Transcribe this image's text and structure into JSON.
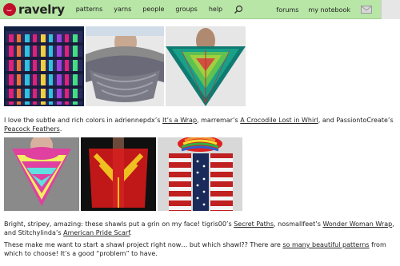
{
  "header": {
    "logo_text": "ravelry",
    "nav": [
      "patterns",
      "yarns",
      "people",
      "groups",
      "help"
    ],
    "right_nav": [
      "forums",
      "my notebook"
    ],
    "colors": {
      "bar": "#b8e6a6",
      "brand_red": "#c0102c"
    },
    "icons": [
      "search-icon",
      "mail-icon",
      "avatar-icon"
    ]
  },
  "paragraph1": {
    "part1": "I love the subtle and rich colors in adriennepdx’s ",
    "link1": "It’s a Wrap",
    "part2": ", marremar’s ",
    "link2": "A Crocodile Lost in Whirl",
    "part3": ", and PassiontoCreate’s ",
    "link3": "Peacock Feathers",
    "part4": "."
  },
  "paragraph2": {
    "part1": "Bright, stripey, amazing: these shawls put a grin on my face! tigris00’s ",
    "link1": "Secret Paths",
    "part2": ", nosmallfeet’s ",
    "link2": "Wonder Woman Wrap",
    "part3": ", and Stitchylinda’s ",
    "link3": "American Pride Scarf",
    "part4": "."
  },
  "paragraph3": {
    "part1": "These make me want to start a shawl project right now… but which shawl?? There are ",
    "link1": "so many beautiful patterns",
    "part2": " from which to choose! It’s a good “problem” to have."
  }
}
